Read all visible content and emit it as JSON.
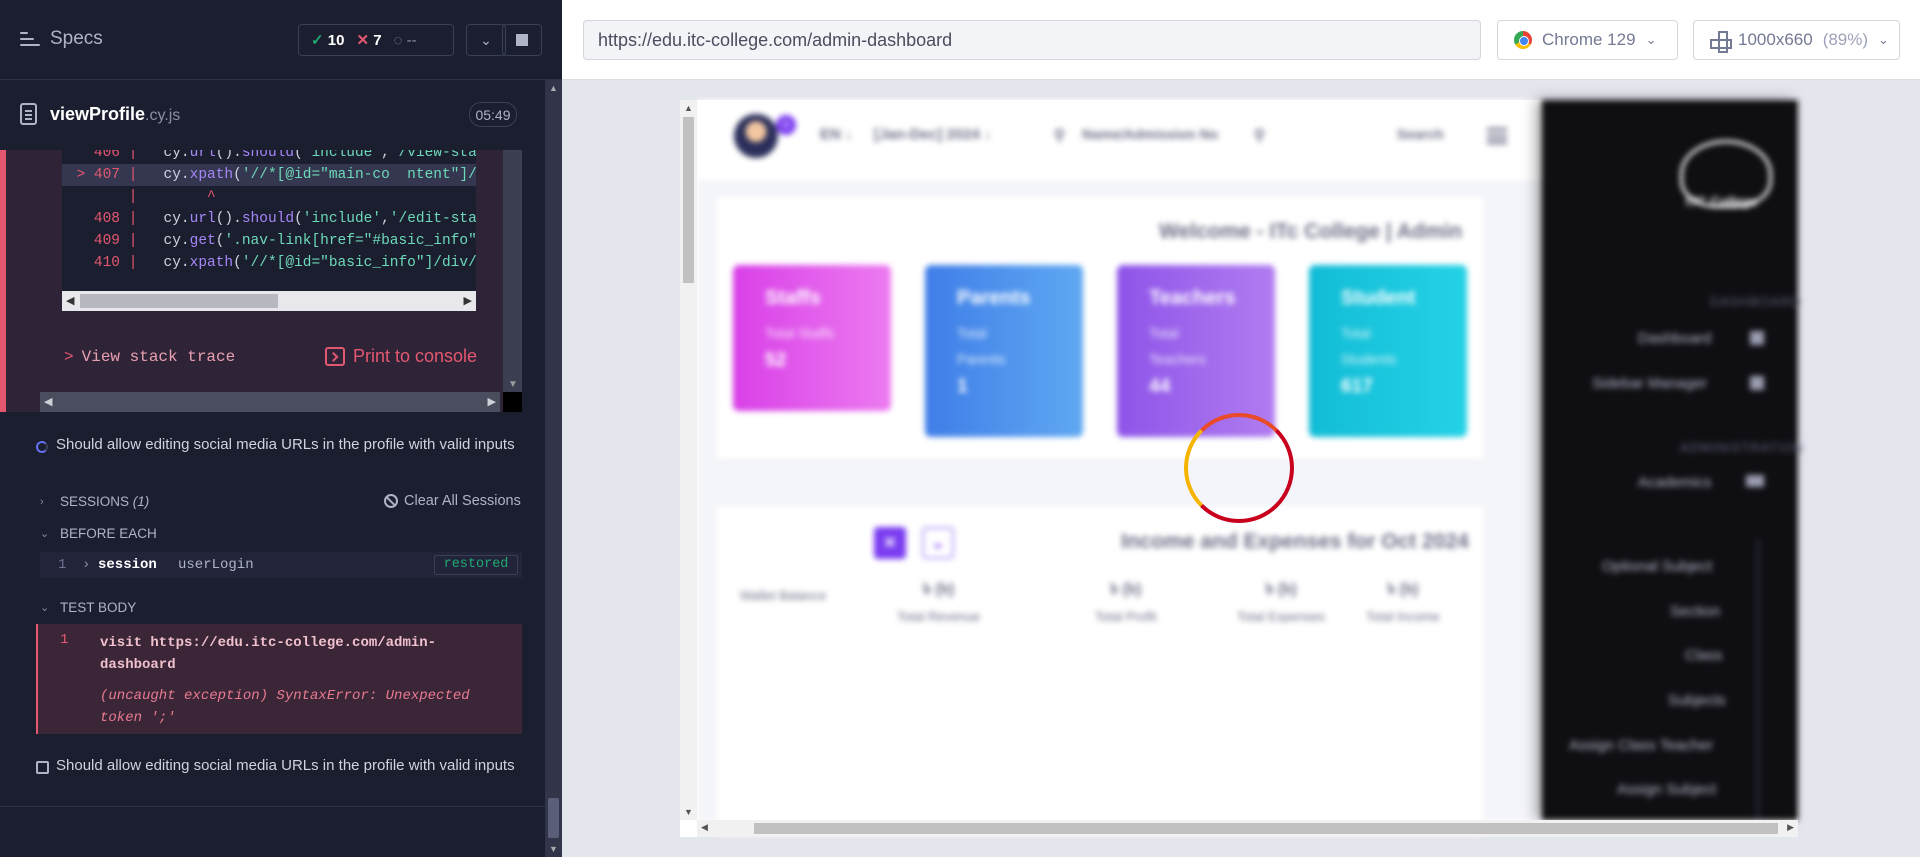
{
  "runner": {
    "header": {
      "title": "Specs",
      "passed": "10",
      "failed": "7",
      "pending": "--"
    },
    "spec": {
      "name": "viewProfile",
      "ext": ".cy.js",
      "duration": "05:49"
    },
    "code_lines": [
      {
        "num": "406",
        "text": "cy.url().should('include','/view-sta"
      },
      {
        "num": "407",
        "text": "cy.xpath('//*[@id=\"main-co  ntent\"]/"
      },
      {
        "num": "",
        "text": "     ^"
      },
      {
        "num": "408",
        "text": "cy.url().should('include','/edit-sta"
      },
      {
        "num": "409",
        "text": "cy.get('.nav-link[href=\"#basic_info\""
      },
      {
        "num": "410",
        "text": "cy.xpath('//*[@id=\"basic_info\"]/div/"
      }
    ],
    "stack_trace_label": "View stack trace",
    "print_to_console_label": "Print to console",
    "test_title_running": "Should allow editing social media URLs in the profile with valid inputs",
    "sessions_label": "SESSIONS",
    "sessions_count": "(1)",
    "clear_sessions_label": "Clear All Sessions",
    "before_each_label": "BEFORE EACH",
    "before_each_cmd": {
      "index": "1",
      "name": "session",
      "arg": "userLogin",
      "status": "restored"
    },
    "test_body_label": "TEST BODY",
    "test_body_cmd": {
      "index": "1",
      "text": "visit https://edu.itc-college.com/admin-dashboard",
      "error": "(uncaught exception)  SyntaxError: Unexpected token ';'"
    },
    "test_title_next": "Should allow editing social media URLs in the profile with valid inputs"
  },
  "browser": {
    "url": "https://edu.itc-college.com/admin-dashboard",
    "browser_label": "Chrome 129",
    "viewport_label": "1000x660",
    "zoom_label": "(89%)"
  },
  "app": {
    "language": "EN",
    "session_year": "[Jan-Dec] 2024",
    "search_placeholder": "Name/Admission No",
    "search_label": "Search",
    "notification_count": "0",
    "welcome": "Welcome - ITc College | Admin",
    "stats": [
      {
        "title": "Staffs",
        "label": "Total Staffs",
        "value": "52"
      },
      {
        "title": "Parents",
        "label": "Total Parents",
        "value": "1"
      },
      {
        "title": "Teachers",
        "label": "Total Teachers",
        "value": "44"
      },
      {
        "title": "Student",
        "label": "Total Students",
        "value": "617"
      }
    ],
    "income_title": "Income and Expenses for Oct 2024",
    "wallet_label": "Wallet Balance",
    "income_items": [
      {
        "value": "৳ (৳)",
        "label": "Total Revenue"
      },
      {
        "value": "৳ (৳)",
        "label": "Total Profit"
      },
      {
        "value": "৳ (৳)",
        "label": "Total Expenses"
      },
      {
        "value": "৳ (৳)",
        "label": "Total Income"
      }
    ],
    "sidebar": {
      "logo_text": "ITC College",
      "dashboard_section": "DASHBOARD",
      "items_top": [
        "Dashboard",
        "Sidebar Manager"
      ],
      "admin_section": "ADMINISTRATION",
      "academics": "Academics",
      "sub_items": [
        "Optional Subject",
        "Section",
        "Class",
        "Subjects",
        "Assign Class Teacher",
        "Assign Subject"
      ]
    }
  },
  "colors": {
    "panel_bg": "#1b1e2e",
    "failed": "#e45770",
    "passed": "#1fa971",
    "staffs_gradient": [
      "#d940e8",
      "#ec7bf0"
    ],
    "parents_gradient": [
      "#3f7ee8",
      "#5fa8f2"
    ],
    "teachers_gradient": [
      "#8e54e9",
      "#b07cf0"
    ],
    "student_gradient": [
      "#12bcd6",
      "#24d2e6"
    ]
  }
}
